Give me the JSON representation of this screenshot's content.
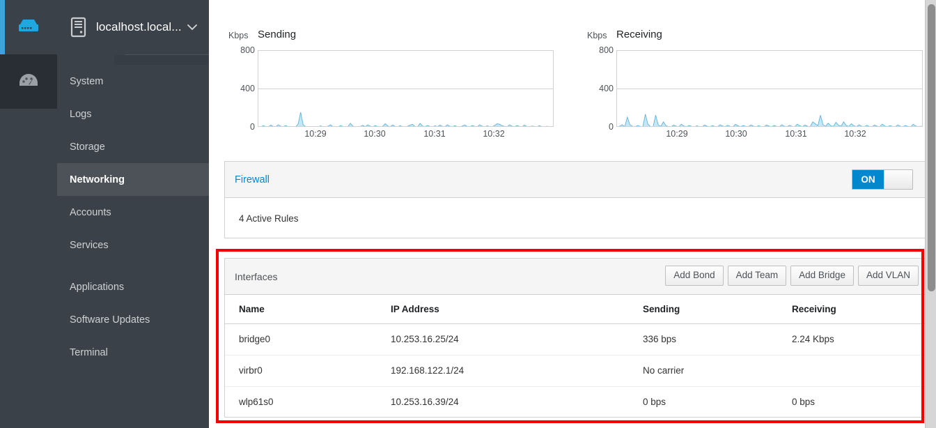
{
  "rail": {
    "brand_icon": "server-storage-icon",
    "items": [
      {
        "icon": "dashboard-gauge-icon",
        "name": "dashboard",
        "active": true
      }
    ]
  },
  "sidebar": {
    "host": {
      "icon": "server-tower-icon",
      "name": "localhost.local...",
      "caret": "⌄"
    },
    "items": [
      {
        "label": "System",
        "active": false,
        "gap_after": false
      },
      {
        "label": "Logs",
        "active": false,
        "gap_after": false
      },
      {
        "label": "Storage",
        "active": false,
        "gap_after": false
      },
      {
        "label": "Networking",
        "active": true,
        "gap_after": false
      },
      {
        "label": "Accounts",
        "active": false,
        "gap_after": false
      },
      {
        "label": "Services",
        "active": false,
        "gap_after": true
      },
      {
        "label": "Applications",
        "active": false,
        "gap_after": false
      },
      {
        "label": "Software Updates",
        "active": false,
        "gap_after": false
      },
      {
        "label": "Terminal",
        "active": false,
        "gap_after": false
      }
    ]
  },
  "charts": {
    "sending": {
      "unit": "Kbps",
      "title": "Sending"
    },
    "receiving": {
      "unit": "Kbps",
      "title": "Receiving"
    }
  },
  "chart_data": [
    {
      "type": "area",
      "title": "Sending",
      "xlabel": "",
      "ylabel": "Kbps",
      "ylim": [
        0,
        800
      ],
      "yticks": [
        0,
        400,
        800
      ],
      "xticks": [
        "10:29",
        "10:30",
        "10:31",
        "10:32"
      ],
      "grid": true,
      "legend": "none",
      "color": "#7cc7e8",
      "values": [
        4,
        8,
        20,
        10,
        6,
        26,
        12,
        8,
        30,
        14,
        9,
        22,
        8,
        5,
        12,
        9,
        38,
        160,
        30,
        10,
        6,
        4,
        12,
        8,
        5,
        18,
        9,
        6,
        14,
        30,
        10,
        6,
        8,
        20,
        12,
        6,
        10,
        45,
        14,
        8,
        6,
        12,
        24,
        9,
        30,
        14,
        8,
        22,
        10,
        6,
        14,
        40,
        18,
        9,
        28,
        12,
        8,
        20,
        10,
        6,
        14,
        26,
        34,
        12,
        8,
        44,
        16,
        10,
        22,
        12,
        7,
        18,
        9,
        26,
        12,
        8,
        30,
        14,
        9,
        20,
        10,
        7,
        16,
        28,
        11,
        8,
        22,
        12,
        9,
        30,
        14,
        8,
        18,
        10,
        7,
        24,
        40,
        35,
        20,
        12,
        8,
        30,
        14,
        9,
        22,
        12,
        8,
        26,
        10,
        7,
        16,
        12,
        8,
        20,
        10,
        6,
        14,
        9,
        7,
        12
      ]
    },
    {
      "type": "area",
      "title": "Receiving",
      "xlabel": "",
      "ylabel": "Kbps",
      "ylim": [
        0,
        800
      ],
      "yticks": [
        0,
        400,
        800
      ],
      "xticks": [
        "10:29",
        "10:30",
        "10:31",
        "10:32"
      ],
      "grid": true,
      "legend": "none",
      "color": "#7cc7e8",
      "values": [
        6,
        14,
        30,
        10,
        110,
        30,
        14,
        8,
        22,
        12,
        8,
        140,
        35,
        12,
        8,
        130,
        28,
        12,
        60,
        20,
        10,
        8,
        26,
        14,
        9,
        36,
        16,
        10,
        22,
        12,
        8,
        18,
        10,
        7,
        26,
        14,
        9,
        20,
        12,
        8,
        30,
        16,
        10,
        24,
        12,
        8,
        34,
        18,
        10,
        22,
        12,
        9,
        28,
        14,
        8,
        20,
        10,
        7,
        26,
        16,
        10,
        22,
        12,
        8,
        30,
        14,
        9,
        24,
        12,
        8,
        36,
        18,
        10,
        26,
        14,
        9,
        60,
        40,
        20,
        130,
        30,
        14,
        45,
        20,
        12,
        55,
        25,
        14,
        60,
        22,
        12,
        40,
        18,
        10,
        30,
        14,
        9,
        24,
        12,
        8,
        26,
        14,
        9,
        36,
        16,
        10,
        20,
        12,
        8,
        28,
        14,
        9,
        22,
        12,
        8,
        35,
        16,
        9,
        14,
        10
      ]
    }
  ],
  "firewall": {
    "title": "Firewall",
    "toggle_label": "ON",
    "toggle_state": "on",
    "active_rules": "4 Active Rules"
  },
  "interfaces": {
    "title": "Interfaces",
    "buttons": [
      {
        "label": "Add Bond"
      },
      {
        "label": "Add Team"
      },
      {
        "label": "Add Bridge"
      },
      {
        "label": "Add VLAN"
      }
    ],
    "columns": [
      "Name",
      "IP Address",
      "Sending",
      "Receiving"
    ],
    "rows": [
      {
        "name": "bridge0",
        "ip": "10.253.16.25/24",
        "sending": "336 bps",
        "receiving": "2.24 Kbps"
      },
      {
        "name": "virbr0",
        "ip": "192.168.122.1/24",
        "sending": "No carrier",
        "receiving": ""
      },
      {
        "name": "wlp61s0",
        "ip": "10.253.16.39/24",
        "sending": "0 bps",
        "receiving": "0 bps"
      }
    ]
  },
  "highlight": {
    "color": "#f50000"
  },
  "colors": {
    "accent": "#0088ce",
    "rail_accent": "#39a5dc",
    "sidebar_bg": "#3a4149",
    "sidebar_active": "#4d5258",
    "chart_fill": "#7cc7e8"
  }
}
